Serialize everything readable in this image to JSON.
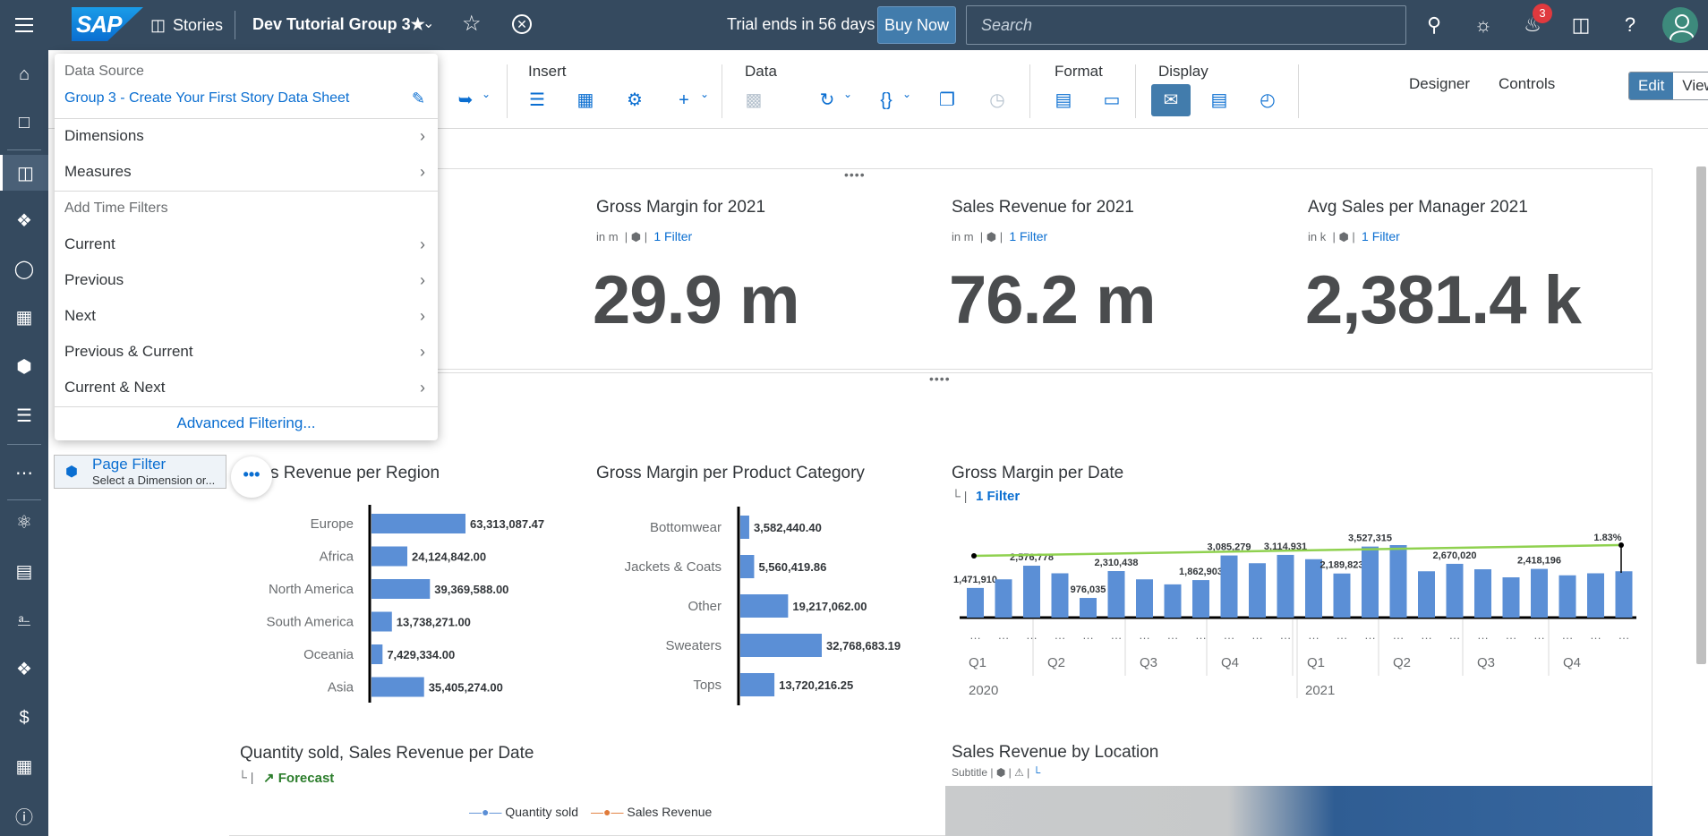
{
  "shell": {
    "logo": "SAP",
    "stories": "Stories",
    "title": "Dev Tutorial Group 3★",
    "trial": "Trial ends in 56 days",
    "buy_now": "Buy Now",
    "search_placeholder": "Search",
    "notification_count": "3"
  },
  "toolbar": {
    "insert": "Insert",
    "data": "Data",
    "format": "Format",
    "display": "Display",
    "designer": "Designer",
    "controls": "Controls",
    "edit": "Edit",
    "view": "View"
  },
  "popover": {
    "data_source_label": "Data Source",
    "data_source": "Group 3 - Create Your First Story Data Sheet",
    "dimensions": "Dimensions",
    "measures": "Measures",
    "add_time_filters": "Add Time Filters",
    "current": "Current",
    "previous": "Previous",
    "next": "Next",
    "previous_current": "Previous & Current",
    "current_next": "Current & Next",
    "advanced": "Advanced Filtering..."
  },
  "page_filter": {
    "title": "Page Filter",
    "subtitle": "Select a Dimension or..."
  },
  "kpis": [
    {
      "title": "Gross Margin for 2021",
      "unit": "in m",
      "filter": "1 Filter",
      "value": "29.9 m"
    },
    {
      "title": "Sales Revenue for 2021",
      "unit": "in m",
      "filter": "1 Filter",
      "value": "76.2 m"
    },
    {
      "title": "Avg Sales per Manager 2021",
      "unit": "in k",
      "filter": "1 Filter",
      "value": "2,381.4 k"
    }
  ],
  "charts": {
    "region_title": "s Revenue per Region",
    "category_title": "Gross Margin per Product Category",
    "date_title": "Gross Margin per Date",
    "date_filter": "1 Filter",
    "qty_title": "Quantity sold, Sales Revenue per Date",
    "forecast": "Forecast",
    "legend_qty": "Quantity sold",
    "legend_rev": "Sales Revenue",
    "location_title": "Sales Revenue by Location",
    "location_subtitle": "Subtitle",
    "trend_label": "1.83%"
  },
  "chart_data": [
    {
      "type": "bar",
      "title": "s Revenue per Region",
      "orientation": "horizontal",
      "categories": [
        "Europe",
        "Africa",
        "North America",
        "South America",
        "Oceania",
        "Asia"
      ],
      "values": [
        63313087.47,
        24124842.0,
        39369588.0,
        13738271.0,
        7429334.0,
        35405274.0
      ],
      "labels": [
        "63,313,087.47",
        "24,124,842.00",
        "39,369,588.00",
        "13,738,271.00",
        "7,429,334.00",
        "35,405,274.00"
      ]
    },
    {
      "type": "bar",
      "title": "Gross Margin per Product Category",
      "orientation": "horizontal",
      "categories": [
        "Bottomwear",
        "Jackets & Coats",
        "Other",
        "Sweaters",
        "Tops"
      ],
      "values": [
        3582440.4,
        5560419.86,
        19217062.0,
        32768683.19,
        13720216.25
      ],
      "labels": [
        "3,582,440.40",
        "5,560,419.86",
        "19,217,062.00",
        "32,768,683.19",
        "13,720,216.25"
      ]
    },
    {
      "type": "bar",
      "title": "Gross Margin per Date",
      "quarters": [
        "Q1",
        "Q2",
        "Q3",
        "Q4",
        "Q1",
        "Q2",
        "Q3",
        "Q4"
      ],
      "years": [
        "2020",
        "2021"
      ],
      "values": [
        1471910,
        1900000,
        2576778,
        2200000,
        976035,
        2310438,
        1900000,
        1650000,
        1862903,
        3085279,
        2700000,
        3114931,
        2900000,
        2189823,
        3527315,
        3600000,
        2300000,
        2670020,
        2400000,
        2000000,
        2418196,
        2100000,
        2200000,
        2300000
      ],
      "labels": [
        "1,471,910",
        "",
        "2,576,778",
        "",
        "976,035",
        "2,310,438",
        "",
        "",
        "1,862,903",
        "3,085,279",
        "",
        "3,114,931",
        "",
        "2,189,823",
        "3,527,315",
        "",
        "",
        "2,670,020",
        "",
        "",
        "2,418,196",
        "",
        "",
        ""
      ]
    }
  ]
}
